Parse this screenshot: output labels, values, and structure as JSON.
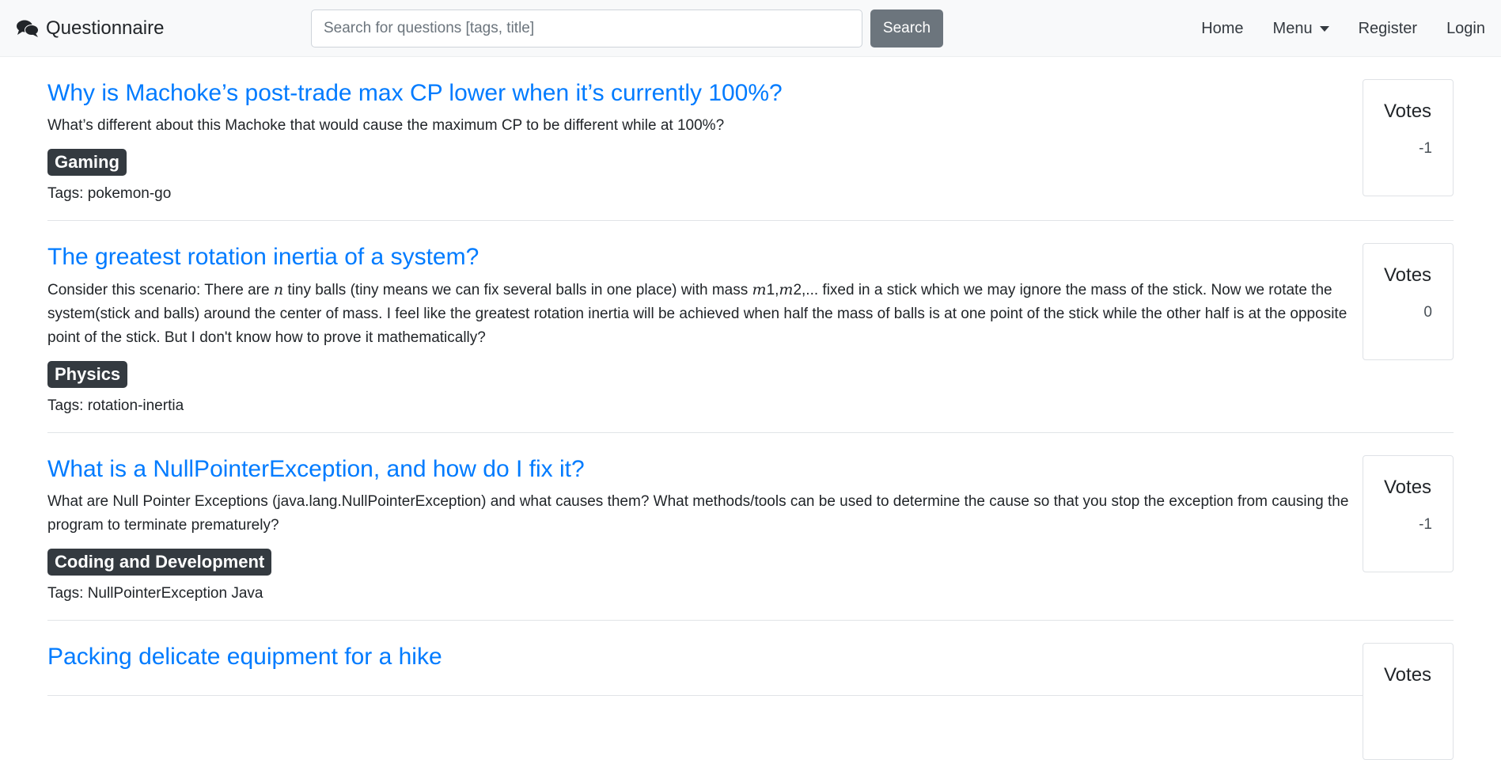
{
  "brand": {
    "name": "Questionnaire",
    "icon": "comments-icon"
  },
  "search": {
    "placeholder": "Search for questions [tags, title]",
    "value": "",
    "button_label": "Search"
  },
  "nav": {
    "home": "Home",
    "menu": "Menu",
    "register": "Register",
    "login": "Login"
  },
  "votes_label": "Votes",
  "questions": [
    {
      "title": "Why is Machoke’s post-trade max CP lower when it’s currently 100%?",
      "body": "What’s different about this Machoke that would cause the maximum CP to be different while at 100%?",
      "category": "Gaming",
      "tags": "Tags: pokemon-go",
      "votes": "-1"
    },
    {
      "title": "The greatest rotation inertia of a system?",
      "body_part1": "Consider this scenario: There are ",
      "body_var_n": "n",
      "body_part2": " tiny balls (tiny means we can fix several balls in one place) with mass ",
      "body_var_m1": "m",
      "body_num_1": "1",
      "body_sep": ",",
      "body_var_m2": "m",
      "body_num_2": "2",
      "body_part3": ",... fixed in a stick which we may ignore the mass of the stick. Now we rotate the system(stick and balls) around the center of mass. I feel like the greatest rotation inertia will be achieved when half the mass of balls is at one point of the stick while the other half is at the opposite point of the stick. But I don't know how to prove it mathematically?",
      "category": "Physics",
      "tags": "Tags: rotation-inertia",
      "votes": "0"
    },
    {
      "title": "What is a NullPointerException, and how do I fix it?",
      "body": "What are Null Pointer Exceptions (java.lang.NullPointerException) and what causes them? What methods/tools can be used to determine the cause so that you stop the exception from causing the program to terminate prematurely?",
      "category": "Coding and Development",
      "tags": "Tags: NullPointerException Java",
      "votes": "-1"
    },
    {
      "title": "Packing delicate equipment for a hike"
    }
  ]
}
